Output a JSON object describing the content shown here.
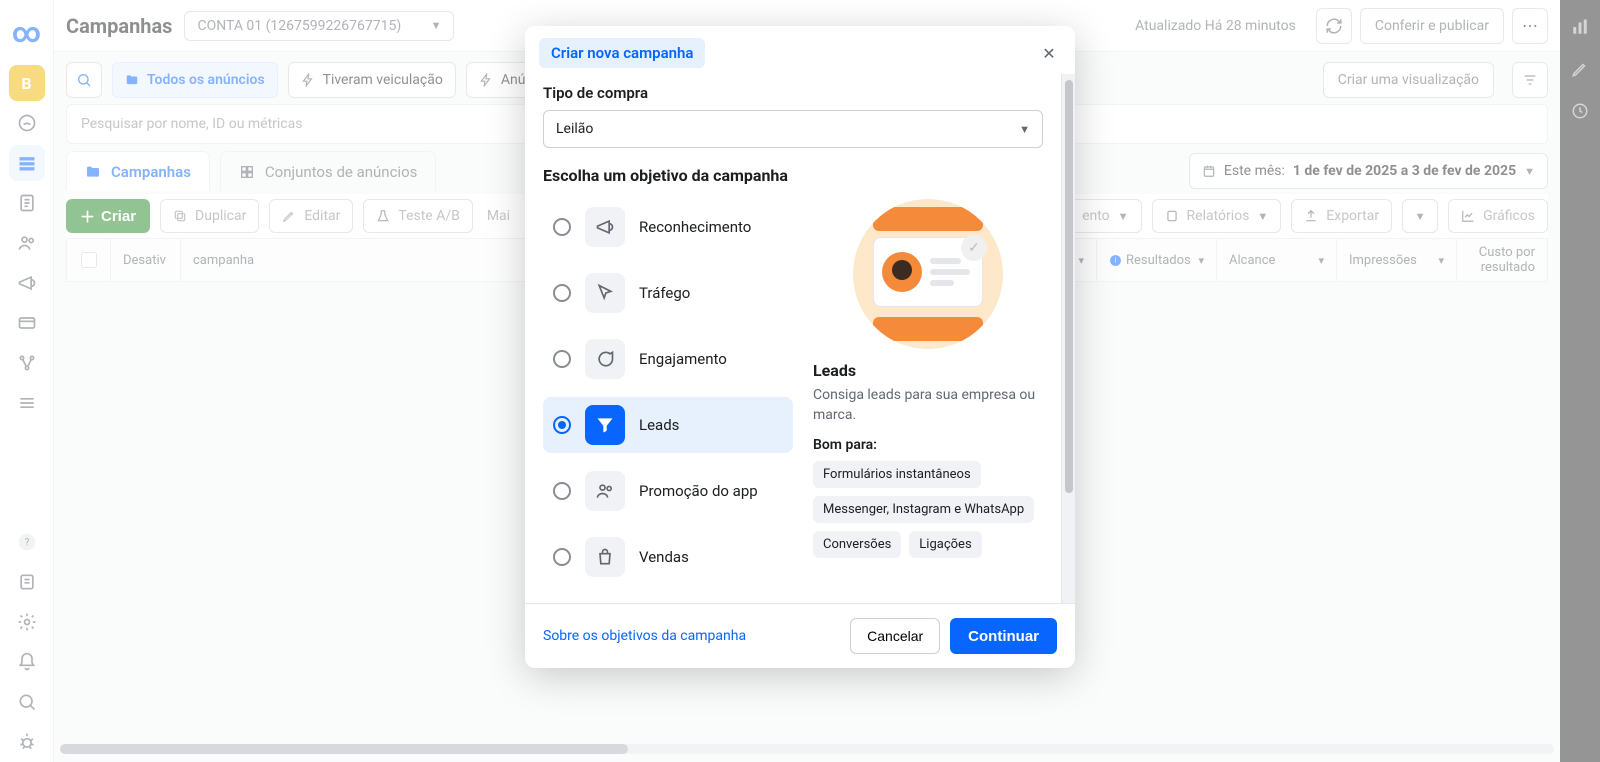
{
  "header": {
    "title": "Campanhas",
    "account": "CONTA 01 (1267599226767715)",
    "updated": "Atualizado Há 28 minutos",
    "review_publish": "Conferir e publicar"
  },
  "filters": {
    "all_ads": "Todos os anúncios",
    "had_delivery": "Tiveram veiculação",
    "ads": "Anúnci",
    "create_view": "Criar uma visualização"
  },
  "search": {
    "placeholder": "Pesquisar por nome, ID ou métricas"
  },
  "tabs": {
    "campaigns": "Campanhas",
    "adsets": "Conjuntos de anúncios"
  },
  "daterange": {
    "prefix": "Este mês:",
    "range": "1 de fev de 2025 a 3 de fev de 2025"
  },
  "toolbar": {
    "create": "Criar",
    "duplicate": "Duplicar",
    "edit": "Editar",
    "abtest": "Teste A/B",
    "more": "Mai",
    "breakdown_suffix": "ento",
    "reports": "Relatórios",
    "export": "Exportar",
    "charts": "Gráficos"
  },
  "columns": {
    "toggle": "Desativ",
    "campaign": "campanha",
    "results": "Resultados",
    "reach": "Alcance",
    "impressions": "Impressões",
    "cost_per_result": "Custo por resultado"
  },
  "modal": {
    "title": "Criar nova campanha",
    "buy_type_label": "Tipo de compra",
    "buy_type_value": "Leilão",
    "objective_label": "Escolha um objetivo da campanha",
    "objectives": {
      "awareness": "Reconhecimento",
      "traffic": "Tráfego",
      "engagement": "Engajamento",
      "leads": "Leads",
      "app_promo": "Promoção do app",
      "sales": "Vendas"
    },
    "detail": {
      "title": "Leads",
      "subtitle": "Consiga leads para sua empresa ou marca.",
      "good_for_label": "Bom para:",
      "pills": [
        "Formulários instantâneos",
        "Messenger, Instagram e WhatsApp",
        "Conversões",
        "Ligações"
      ]
    },
    "footer": {
      "about_link": "Sobre os objetivos da campanha",
      "cancel": "Cancelar",
      "continue": "Continuar"
    }
  }
}
